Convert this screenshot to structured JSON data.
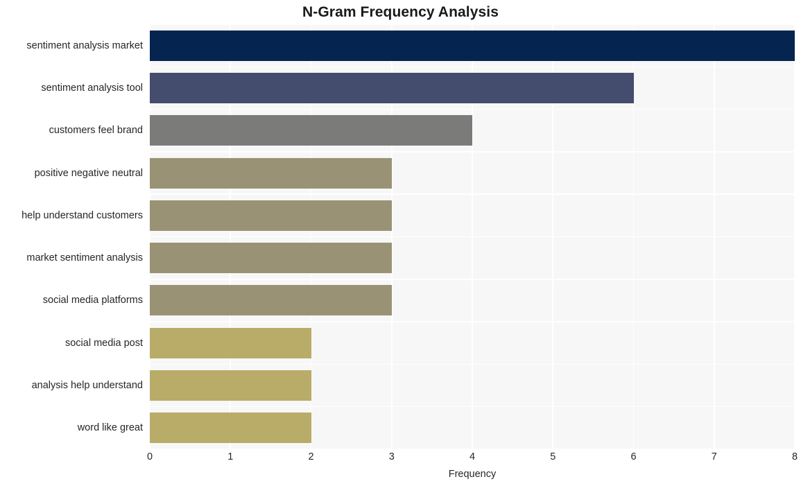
{
  "chart_data": {
    "type": "bar",
    "orientation": "horizontal",
    "title": "N-Gram Frequency Analysis",
    "xlabel": "Frequency",
    "ylabel": "",
    "xlim": [
      0,
      8
    ],
    "grid": true,
    "legend": "none",
    "x_ticks": [
      "0",
      "1",
      "2",
      "3",
      "4",
      "5",
      "6",
      "7",
      "8"
    ],
    "x_tick_values": [
      0,
      1,
      2,
      3,
      4,
      5,
      6,
      7,
      8
    ],
    "categories": [
      "sentiment analysis market",
      "sentiment analysis tool",
      "customers feel brand",
      "positive negative neutral",
      "help understand customers",
      "market sentiment analysis",
      "social media platforms",
      "social media post",
      "analysis help understand",
      "word like great"
    ],
    "values": [
      8,
      6,
      4,
      3,
      3,
      3,
      3,
      2,
      2,
      2
    ],
    "bar_colors": [
      "#052550",
      "#444d6e",
      "#7b7b79",
      "#999274",
      "#999274",
      "#999274",
      "#999274",
      "#b8ac68",
      "#b8ac68",
      "#b8ac68"
    ]
  },
  "style": {
    "plot_background": "#f7f7f7",
    "figure_background": "#ffffff",
    "gridline_color": "#ffffff",
    "text_color": "#262626",
    "title_color": "#1a1a1a"
  }
}
